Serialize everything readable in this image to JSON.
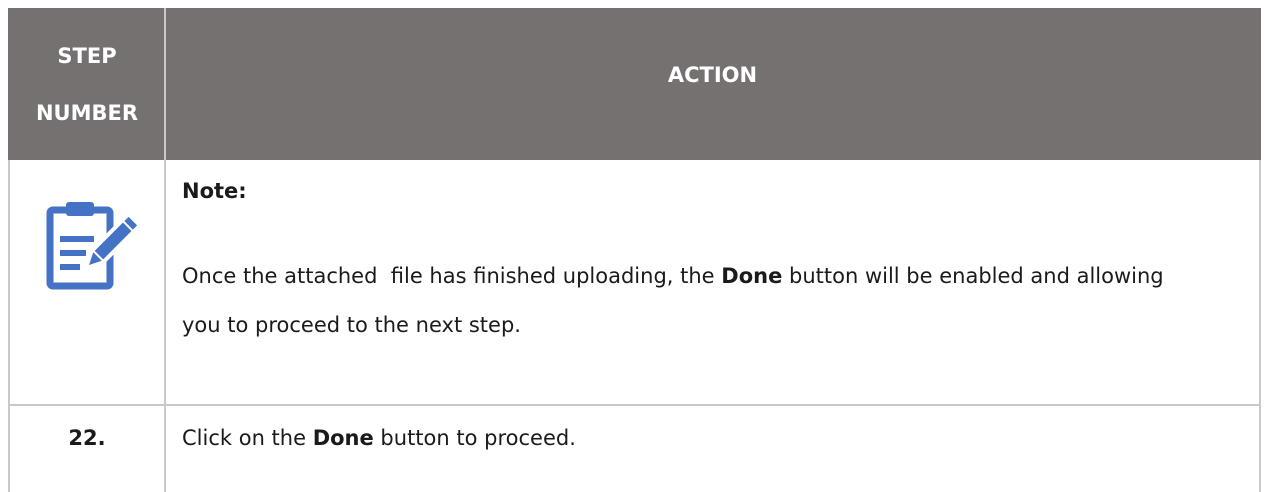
{
  "table": {
    "header": {
      "step_line1": "STEP",
      "step_line2": "NUMBER",
      "action": "ACTION"
    },
    "note_row": {
      "icon": "notepad-pencil-icon",
      "label": "Note:",
      "text_before": "Once the attached  file has finished uploading, the ",
      "text_bold": "Done",
      "text_after": " button will be enabled and allowing you to proceed to the next step."
    },
    "step_row": {
      "number": "22.",
      "text_before": "Click on the ",
      "text_bold": "Done",
      "text_after": " button to proceed."
    }
  },
  "colors": {
    "header_bg": "#767171",
    "header_text": "#ffffff",
    "border": "#c9c9c9",
    "icon": "#4472c4"
  }
}
